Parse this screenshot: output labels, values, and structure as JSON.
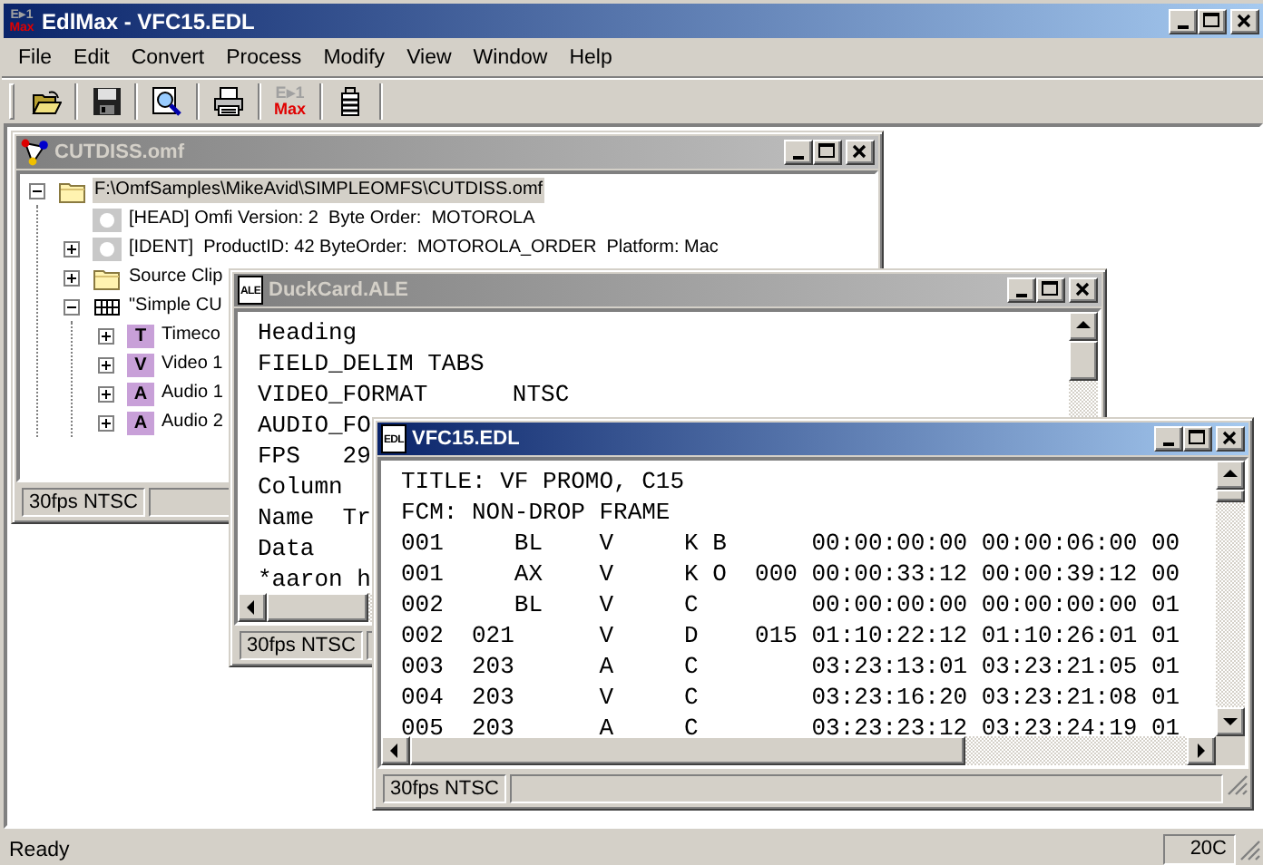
{
  "app": {
    "title": "EdlMax - VFC15.EDL",
    "active": true,
    "icon": {
      "top": "E▸1",
      "bottom": "Max"
    }
  },
  "menu": [
    "File",
    "Edit",
    "Convert",
    "Process",
    "Modify",
    "View",
    "Window",
    "Help"
  ],
  "toolbar": [
    {
      "kind": "open"
    },
    {
      "kind": "save"
    },
    {
      "kind": "find"
    },
    {
      "kind": "print"
    },
    {
      "kind": "logo",
      "top": "E▸1",
      "bottom": "Max"
    },
    {
      "kind": "battery"
    }
  ],
  "windows": [
    {
      "title": "CUTDISS.omf",
      "active": false,
      "kind": "tree",
      "icon": {
        "kind": "omf"
      },
      "scrollbars": false,
      "status": [
        "30fps NTSC"
      ],
      "tree": [
        {
          "label": "F:\\OmfSamples\\MikeAvid\\SIMPLEOMFS\\CUTDISS.omf",
          "kind": "folder",
          "selected": true,
          "expanded": true,
          "children": [
            {
              "label": "[HEAD] Omfi Version: 2  Byte Order:  MOTOROLA",
              "kind": "disc",
              "selected": false
            },
            {
              "label": "[IDENT]  ProductID: 42 ByteOrder:  MOTOROLA_ORDER  Platform: Mac",
              "kind": "disc",
              "selected": false,
              "expanded": false
            },
            {
              "label": "Source Clip",
              "kind": "folder",
              "selected": false,
              "expanded": false
            },
            {
              "label": "\"Simple CU",
              "kind": "grid",
              "selected": false,
              "expanded": true,
              "children": [
                {
                  "label": "Timeco",
                  "kind": "badge",
                  "badge": "T",
                  "selected": false,
                  "expanded": false
                },
                {
                  "label": "Video 1",
                  "kind": "badge",
                  "badge": "V",
                  "selected": false,
                  "expanded": false
                },
                {
                  "label": "Audio 1",
                  "kind": "badge",
                  "badge": "A",
                  "selected": false,
                  "expanded": false
                },
                {
                  "label": "Audio 2",
                  "kind": "badge",
                  "badge": "A",
                  "selected": false,
                  "expanded": false
                }
              ]
            }
          ]
        }
      ]
    },
    {
      "title": "DuckCard.ALE",
      "active": false,
      "kind": "text",
      "icon": {
        "kind": "doc",
        "label": "ALE"
      },
      "scrollbars": true,
      "status": [
        "30fps NTSC"
      ],
      "lines": [
        "Heading",
        "FIELD_DELIM TABS",
        "VIDEO_FORMAT      NTSC",
        "AUDIO_FO",
        "FPS   29",
        "Column",
        "Name  Tr",
        "Data",
        "*aaron h"
      ]
    },
    {
      "title": "VFC15.EDL",
      "active": true,
      "kind": "text",
      "icon": {
        "kind": "doc",
        "label": "EDL"
      },
      "scrollbars": true,
      "status": [
        "30fps NTSC"
      ],
      "lines": [
        "TITLE: VF PROMO, C15",
        "FCM: NON-DROP FRAME",
        "001     BL    V     K B      00:00:00:00 00:00:06:00 00",
        "001     AX    V     K O  000 00:00:33:12 00:00:39:12 00",
        "002     BL    V     C        00:00:00:00 00:00:00:00 01",
        "002  021      V     D    015 01:10:22:12 01:10:26:01 01",
        "003  203      A     C        03:23:13:01 03:23:21:05 01",
        "004  203      V     C        03:23:16:20 03:23:21:08 01",
        "005  203      A     C        03:23:23:12 03:23:24:19 01"
      ]
    }
  ],
  "status_bar": {
    "message": "Ready",
    "panel": "20C"
  }
}
